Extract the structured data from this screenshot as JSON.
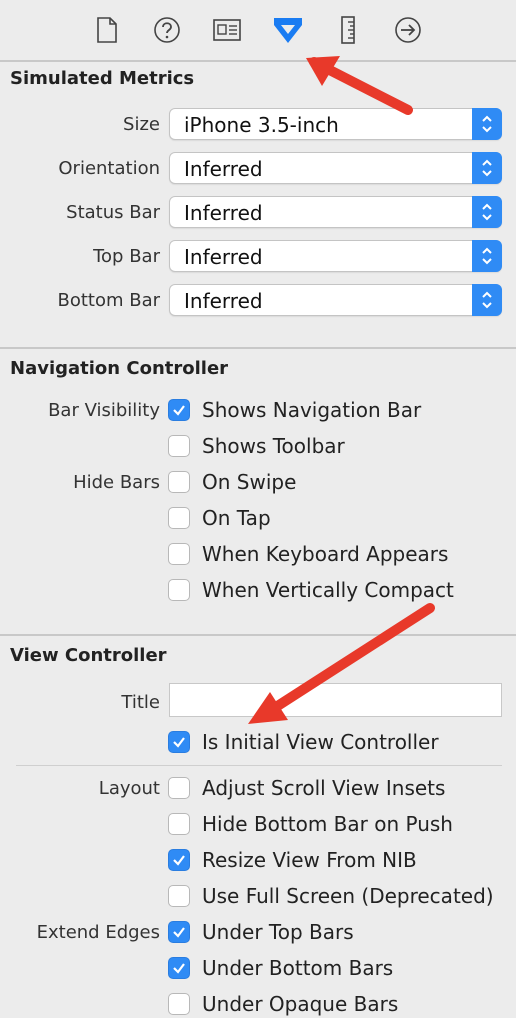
{
  "toolbar": {
    "icons": [
      "file-icon",
      "help-icon",
      "identity-icon",
      "attributes-icon",
      "size-ruler-icon",
      "connections-icon"
    ],
    "active_icon": "attributes-icon",
    "accent_color": "#1a7cf2"
  },
  "simulated_metrics": {
    "title": "Simulated Metrics",
    "rows": [
      {
        "label": "Size",
        "value": "iPhone 3.5-inch"
      },
      {
        "label": "Orientation",
        "value": "Inferred"
      },
      {
        "label": "Status Bar",
        "value": "Inferred"
      },
      {
        "label": "Top Bar",
        "value": "Inferred"
      },
      {
        "label": "Bottom Bar",
        "value": "Inferred"
      }
    ]
  },
  "navigation_controller": {
    "title": "Navigation Controller",
    "bar_visibility_label": "Bar Visibility",
    "hide_bars_label": "Hide Bars",
    "options": [
      {
        "label": "Shows Navigation Bar",
        "checked": true
      },
      {
        "label": "Shows Toolbar",
        "checked": false
      },
      {
        "label": "On Swipe",
        "checked": false
      },
      {
        "label": "On Tap",
        "checked": false
      },
      {
        "label": "When Keyboard Appears",
        "checked": false
      },
      {
        "label": "When Vertically Compact",
        "checked": false
      }
    ]
  },
  "view_controller": {
    "title": "View Controller",
    "title_field_label": "Title",
    "title_field_value": "",
    "initial_vc_label": "Is Initial View Controller",
    "initial_vc_checked": true,
    "layout_label": "Layout",
    "extend_edges_label": "Extend Edges",
    "layout_options": [
      {
        "label": "Adjust Scroll View Insets",
        "checked": false
      },
      {
        "label": "Hide Bottom Bar on Push",
        "checked": false
      },
      {
        "label": "Resize View From NIB",
        "checked": true
      },
      {
        "label": "Use Full Screen (Deprecated)",
        "checked": false
      }
    ],
    "extend_edges_options": [
      {
        "label": "Under Top Bars",
        "checked": true
      },
      {
        "label": "Under Bottom Bars",
        "checked": true
      },
      {
        "label": "Under Opaque Bars",
        "checked": false
      }
    ]
  },
  "annotation_color": "#e8392a"
}
